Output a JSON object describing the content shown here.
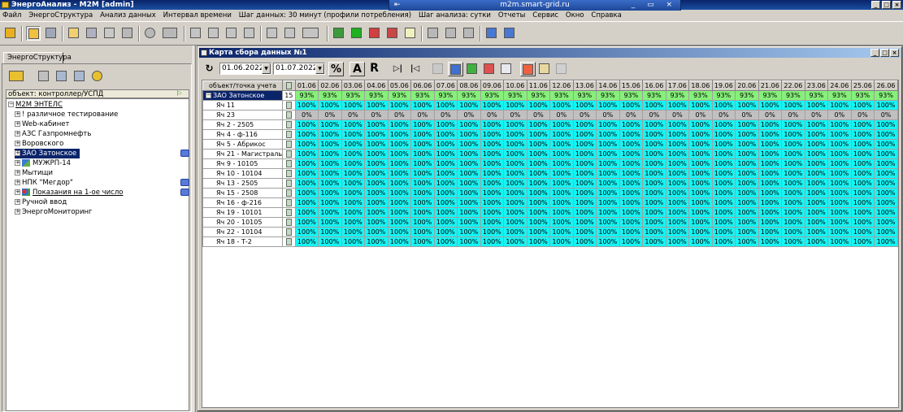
{
  "app": {
    "title": "ЭнергоАнализ - M2M [admin]"
  },
  "rdp": {
    "host": "m2m.smart-grid.ru"
  },
  "menu": [
    "Файл",
    "ЭнергоСтруктура",
    "Анализ данных",
    "Интервал времени",
    "Шаг данных: 30 минут (профили потребления)",
    "Шаг анализа: сутки",
    "Отчеты",
    "Сервис",
    "Окно",
    "Справка"
  ],
  "left": {
    "tab": "ЭнергоСтруктура",
    "object_header": "объект: контроллер/УСПД",
    "tree": {
      "root": "М2М ЭНТЕЛС",
      "items": [
        "! различное тестирование",
        "Web-кабинет",
        "АЗС Газпромнефть",
        "Воровского",
        "ЗАО Затонское",
        "МУЖРП-14",
        "Мытищи",
        "НПК \"Мегдор\"",
        "Показания на 1-ое число",
        "Ручной ввод",
        "ЭнергоМониторинг"
      ]
    }
  },
  "window": {
    "title": "Карта сбора данных №1"
  },
  "toolbar2": {
    "date_from": "01.06.2022",
    "date_to": "01.07.2022",
    "percent": "%",
    "A": "A",
    "R": "R"
  },
  "grid": {
    "corner": "объект/точка учета",
    "dates": [
      "01.06",
      "02.06",
      "03.06",
      "04.06",
      "05.06",
      "06.06",
      "07.06",
      "08.06",
      "09.06",
      "10.06",
      "11.06",
      "12.06",
      "13.06",
      "14.06",
      "15.06",
      "16.06",
      "17.06",
      "18.06",
      "19.06",
      "20.06",
      "21.06",
      "22.06",
      "23.06",
      "24.06",
      "25.06",
      "26.06"
    ],
    "group": {
      "name": "ЗАО Затонское",
      "count": "15",
      "value": "93%",
      "values_percent": 93
    },
    "rows": [
      {
        "name": "Яч 11",
        "value": "100%",
        "status": "full"
      },
      {
        "name": "Яч 23",
        "value": "0%",
        "status": "none"
      },
      {
        "name": "Яч 2 - 2505",
        "value": "100%",
        "status": "full"
      },
      {
        "name": "Яч 4 - ф-116",
        "value": "100%",
        "status": "full"
      },
      {
        "name": "Яч 5 - Абрикос",
        "value": "100%",
        "status": "full"
      },
      {
        "name": "Яч 21 - Магистраль",
        "value": "100%",
        "status": "full"
      },
      {
        "name": "Яч 9 - 10105",
        "value": "100%",
        "status": "full"
      },
      {
        "name": "Яч 10 - 10104",
        "value": "100%",
        "status": "full"
      },
      {
        "name": "Яч 13 - 2505",
        "value": "100%",
        "status": "full"
      },
      {
        "name": "Яч 15 - 2508",
        "value": "100%",
        "status": "full"
      },
      {
        "name": "Яч 16 - ф-216",
        "value": "100%",
        "status": "full"
      },
      {
        "name": "Яч 19 - 10101",
        "value": "100%",
        "status": "full"
      },
      {
        "name": "Яч 20 - 10105",
        "value": "100%",
        "status": "full"
      },
      {
        "name": "Яч 22 - 10104",
        "value": "100%",
        "status": "full"
      },
      {
        "name": "Яч 18 - Т-2",
        "value": "100%",
        "status": "full"
      }
    ]
  },
  "colors": {
    "full": "#15f5f5",
    "partial": "#86f07a",
    "none": "#c0c0c0",
    "selection": "#0a246a"
  },
  "icons": [
    "user-login-icon",
    "tree-view-icon",
    "report-icon",
    "folder-open-icon",
    "save-icon",
    "print-icon",
    "delete-icon",
    "connect-icon",
    "settings-icon",
    "chart-icon",
    "excel-icon",
    "play-icon",
    "export-icon",
    "calendar-icon",
    "refresh-icon",
    "expand-icon",
    "collapse-icon",
    "search-icon"
  ]
}
